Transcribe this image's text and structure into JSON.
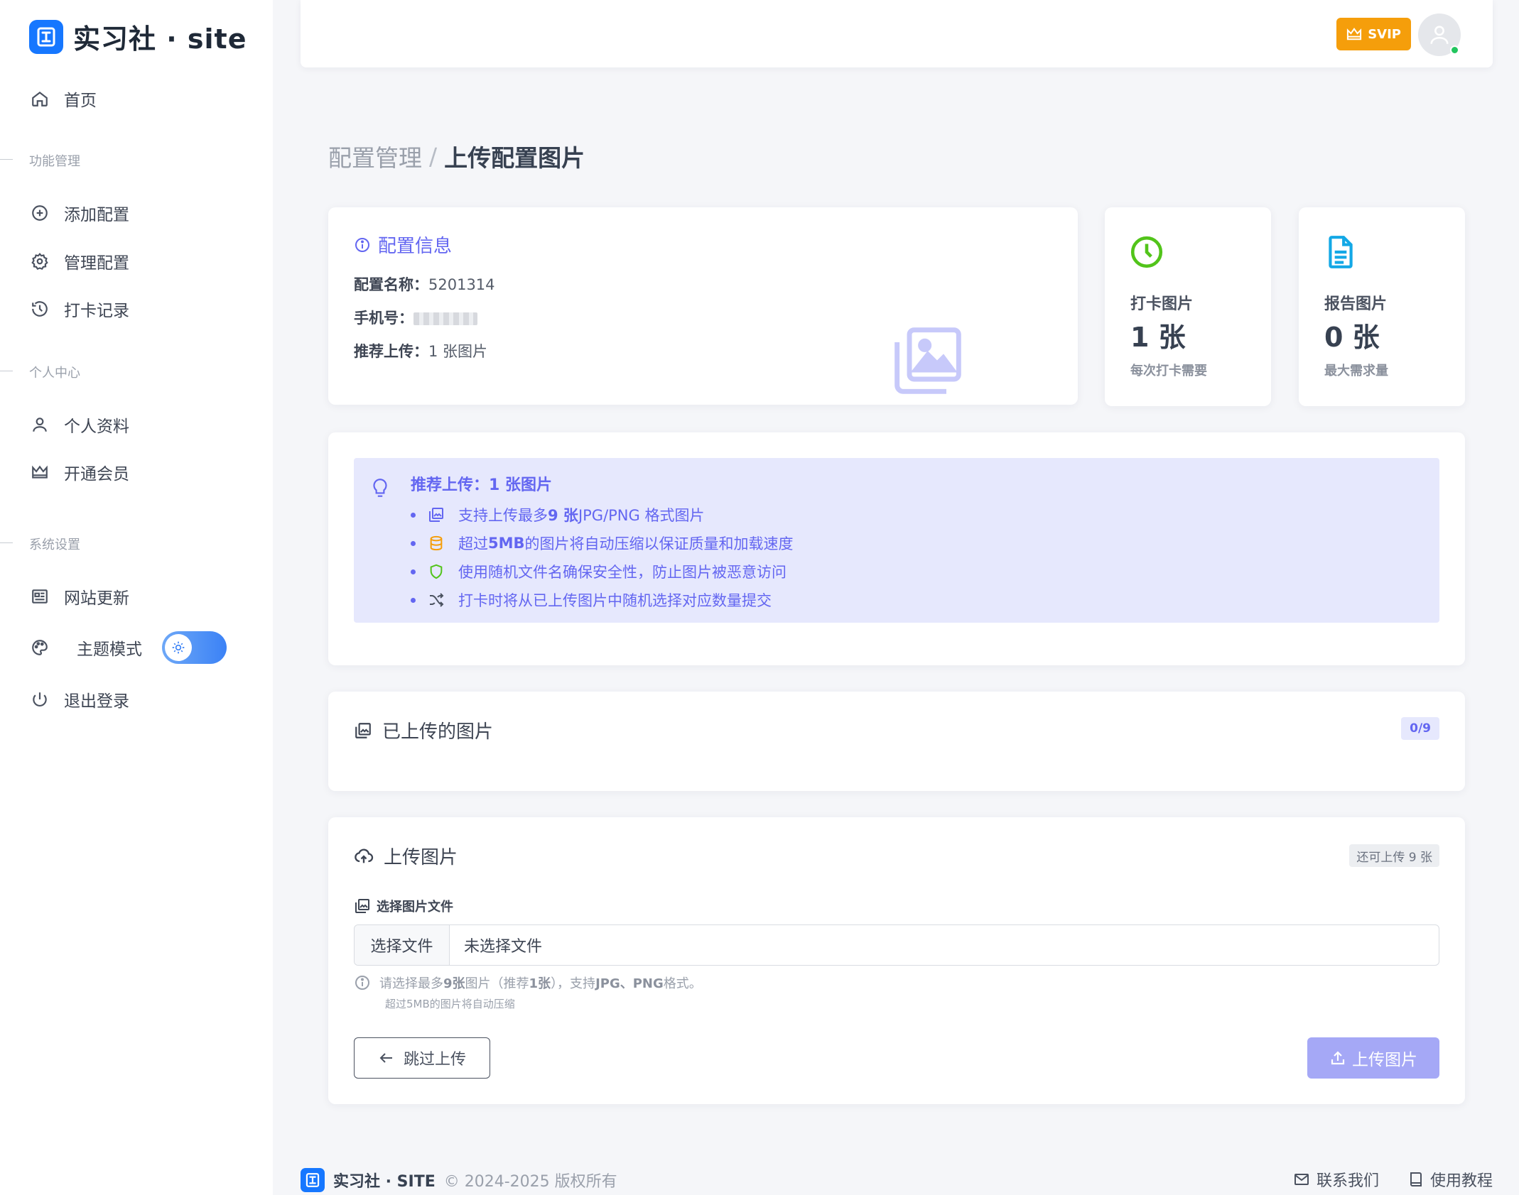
{
  "brand": {
    "name": "实习社 · site"
  },
  "sidebar": {
    "home": "首页",
    "sections": {
      "features": "功能管理",
      "personal": "个人中心",
      "system": "系统设置"
    },
    "items": {
      "add_config": "添加配置",
      "manage_config": "管理配置",
      "checkin_records": "打卡记录",
      "profile": "个人资料",
      "membership": "开通会员",
      "site_updates": "网站更新",
      "theme_mode": "主题模式",
      "logout": "退出登录"
    }
  },
  "header": {
    "svip_label": "SVIP"
  },
  "breadcrumb": {
    "parent": "配置管理",
    "separator": "/",
    "current": "上传配置图片"
  },
  "config_info": {
    "title": "配置信息",
    "name_label": "配置名称：",
    "name_value": "5201314",
    "phone_label": "手机号：",
    "recommend_label": "推荐上传：",
    "recommend_value": "1 张图片"
  },
  "stats": [
    {
      "label": "打卡图片",
      "value": "1 张",
      "sub": "每次打卡需要",
      "icon": "clock-icon",
      "color": "#52c41a"
    },
    {
      "label": "报告图片",
      "value": "0 张",
      "sub": "最大需求量",
      "icon": "document-icon",
      "color": "#13a8e6"
    }
  ],
  "tips": {
    "heading": "推荐上传：1 张图片",
    "items": [
      {
        "pre": "支持上传最多 ",
        "strong": "9 张",
        "post": " JPG/PNG 格式图片",
        "icon": "images-icon"
      },
      {
        "pre": "超过 ",
        "strong": "5MB",
        "post": " 的图片将自动压缩以保证质量和加载速度",
        "icon": "database-icon"
      },
      {
        "pre": "使用随机文件名确保安全性，防止图片被恶意访问",
        "strong": "",
        "post": "",
        "icon": "shield-icon"
      },
      {
        "pre": "打卡时将从已上传图片中随机选择对应数量提交",
        "strong": "",
        "post": "",
        "icon": "shuffle-icon"
      }
    ]
  },
  "uploaded": {
    "title": "已上传的图片",
    "count": "0/9"
  },
  "upload": {
    "title": "上传图片",
    "remaining": "还可上传 9 张",
    "field_label": "选择图片文件",
    "file_button": "选择文件",
    "file_placeholder": "未选择文件",
    "hint_pre": "请选择最多 ",
    "hint_max": "9张",
    "hint_mid": " 图片（推荐 ",
    "hint_rec": "1张",
    "hint_post": "），支持 ",
    "hint_formats": "JPG、PNG",
    "hint_end": " 格式。",
    "hint_sub": "超过5MB的图片将自动压缩",
    "skip_label": "跳过上传",
    "upload_label": "上传图片"
  },
  "footer": {
    "brand": "实习社 · SITE",
    "copyright": "© 2024-2025 版权所有",
    "contact": "联系我们",
    "tutorial": "使用教程"
  }
}
